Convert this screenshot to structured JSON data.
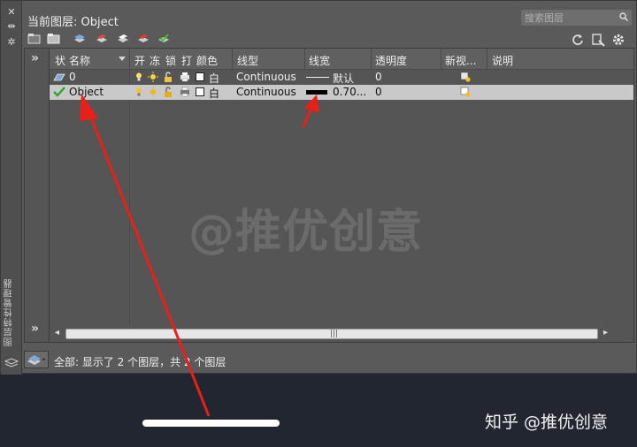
{
  "palette": {
    "side_title": "图层特性管理器",
    "current_layer_label": "当前图层: Object",
    "search_placeholder": "搜索图层"
  },
  "columns": [
    "状",
    "名称",
    "开",
    "冻",
    "锁",
    "打",
    "颜色",
    "线型",
    "线宽",
    "透明度",
    "新视...",
    "说明"
  ],
  "layers": [
    {
      "name": "0",
      "color": "白",
      "linetype": "Continuous",
      "lineweight": "默认",
      "transparency": "0",
      "status_icon": "layer-parallelogram-icon"
    },
    {
      "name": "Object",
      "color": "白",
      "linetype": "Continuous",
      "lineweight": "0.70...",
      "transparency": "0",
      "status_icon": "current-checkmark-icon"
    }
  ],
  "status_bar": {
    "text": "全部: 显示了 2 个图层，共 2 个图层"
  },
  "watermark": "@推优创意",
  "source_mark": "知乎 @推优创意",
  "colors": {
    "palette_bg": "#5a5a5a",
    "selected_row": "#c9c9c9",
    "annotation_arrow": "#e8201a",
    "desktop": "#212630"
  }
}
